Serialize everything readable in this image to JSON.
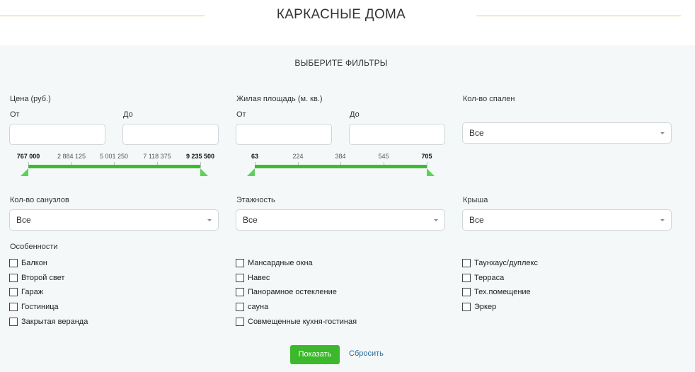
{
  "header": {
    "title": "КАРКАСНЫЕ ДОМА"
  },
  "filters": {
    "title": "ВЫБЕРИТЕ ФИЛЬТРЫ",
    "price": {
      "label": "Цена (руб.)",
      "from_label": "От",
      "to_label": "До",
      "from_value": "",
      "to_value": "",
      "ticks": [
        "767 000",
        "2 884 125",
        "5 001 250",
        "7 118 375",
        "9 235 500"
      ]
    },
    "area": {
      "label": "Жилая площадь (м. кв.)",
      "from_label": "От",
      "to_label": "До",
      "from_value": "",
      "to_value": "",
      "ticks": [
        "63",
        "224",
        "384",
        "545",
        "705"
      ]
    },
    "bedrooms": {
      "label": "Кол-во спален",
      "value": "Все"
    },
    "bathrooms": {
      "label": "Кол-во санузлов",
      "value": "Все"
    },
    "floors": {
      "label": "Этажность",
      "value": "Все"
    },
    "roof": {
      "label": "Крыша",
      "value": "Все"
    },
    "features": {
      "label": "Особенности",
      "col1": [
        "Балкон",
        "Второй свет",
        "Гараж",
        "Гостиница",
        "Закрытая веранда"
      ],
      "col2": [
        "Мансардные окна",
        "Навес",
        "Панорамное остекление",
        "сауна",
        "Совмещенные кухня-гостиная"
      ],
      "col3": [
        "Таунхаус/дуплекс",
        "Терраса",
        "Тех.помещение",
        "Эркер"
      ]
    },
    "show_button": "Показать",
    "reset_link": "Сбросить"
  },
  "colors": {
    "accent_green": "#3cbd2f",
    "header_line": "#f0d060",
    "panel_bg": "#f4f8f8",
    "link": "#2a6a9a"
  }
}
